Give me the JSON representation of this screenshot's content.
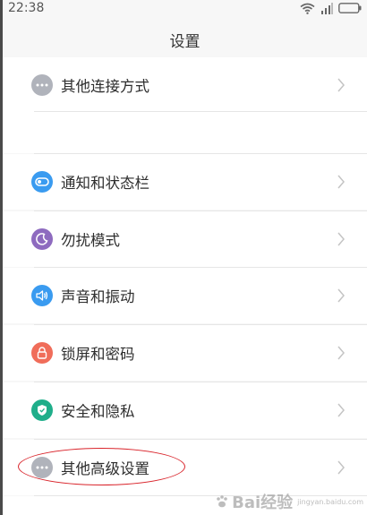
{
  "status_bar": {
    "time": "22:38",
    "icons": [
      "wifi-icon",
      "signal-icon",
      "battery-icon"
    ]
  },
  "header": {
    "title": "设置"
  },
  "settings": {
    "items": [
      {
        "label": "其他连接方式",
        "icon": "more-icon",
        "color": "#b0b3bb"
      },
      {
        "label": "通知和状态栏",
        "icon": "toggle-icon",
        "color": "#3a9bf0"
      },
      {
        "label": "勿扰模式",
        "icon": "moon-icon",
        "color": "#8e6bbf"
      },
      {
        "label": "声音和振动",
        "icon": "speaker-icon",
        "color": "#3a9bf0"
      },
      {
        "label": "锁屏和密码",
        "icon": "lock-icon",
        "color": "#f06d5a"
      },
      {
        "label": "安全和隐私",
        "icon": "shield-icon",
        "color": "#1fae8a"
      },
      {
        "label": "其他高级设置",
        "icon": "more-icon",
        "color": "#b0b3bb"
      }
    ]
  },
  "watermark": {
    "text": "Bai经验",
    "sub": "jingyan.baidu.com"
  },
  "colors": {
    "annotation": "#d9232a"
  }
}
